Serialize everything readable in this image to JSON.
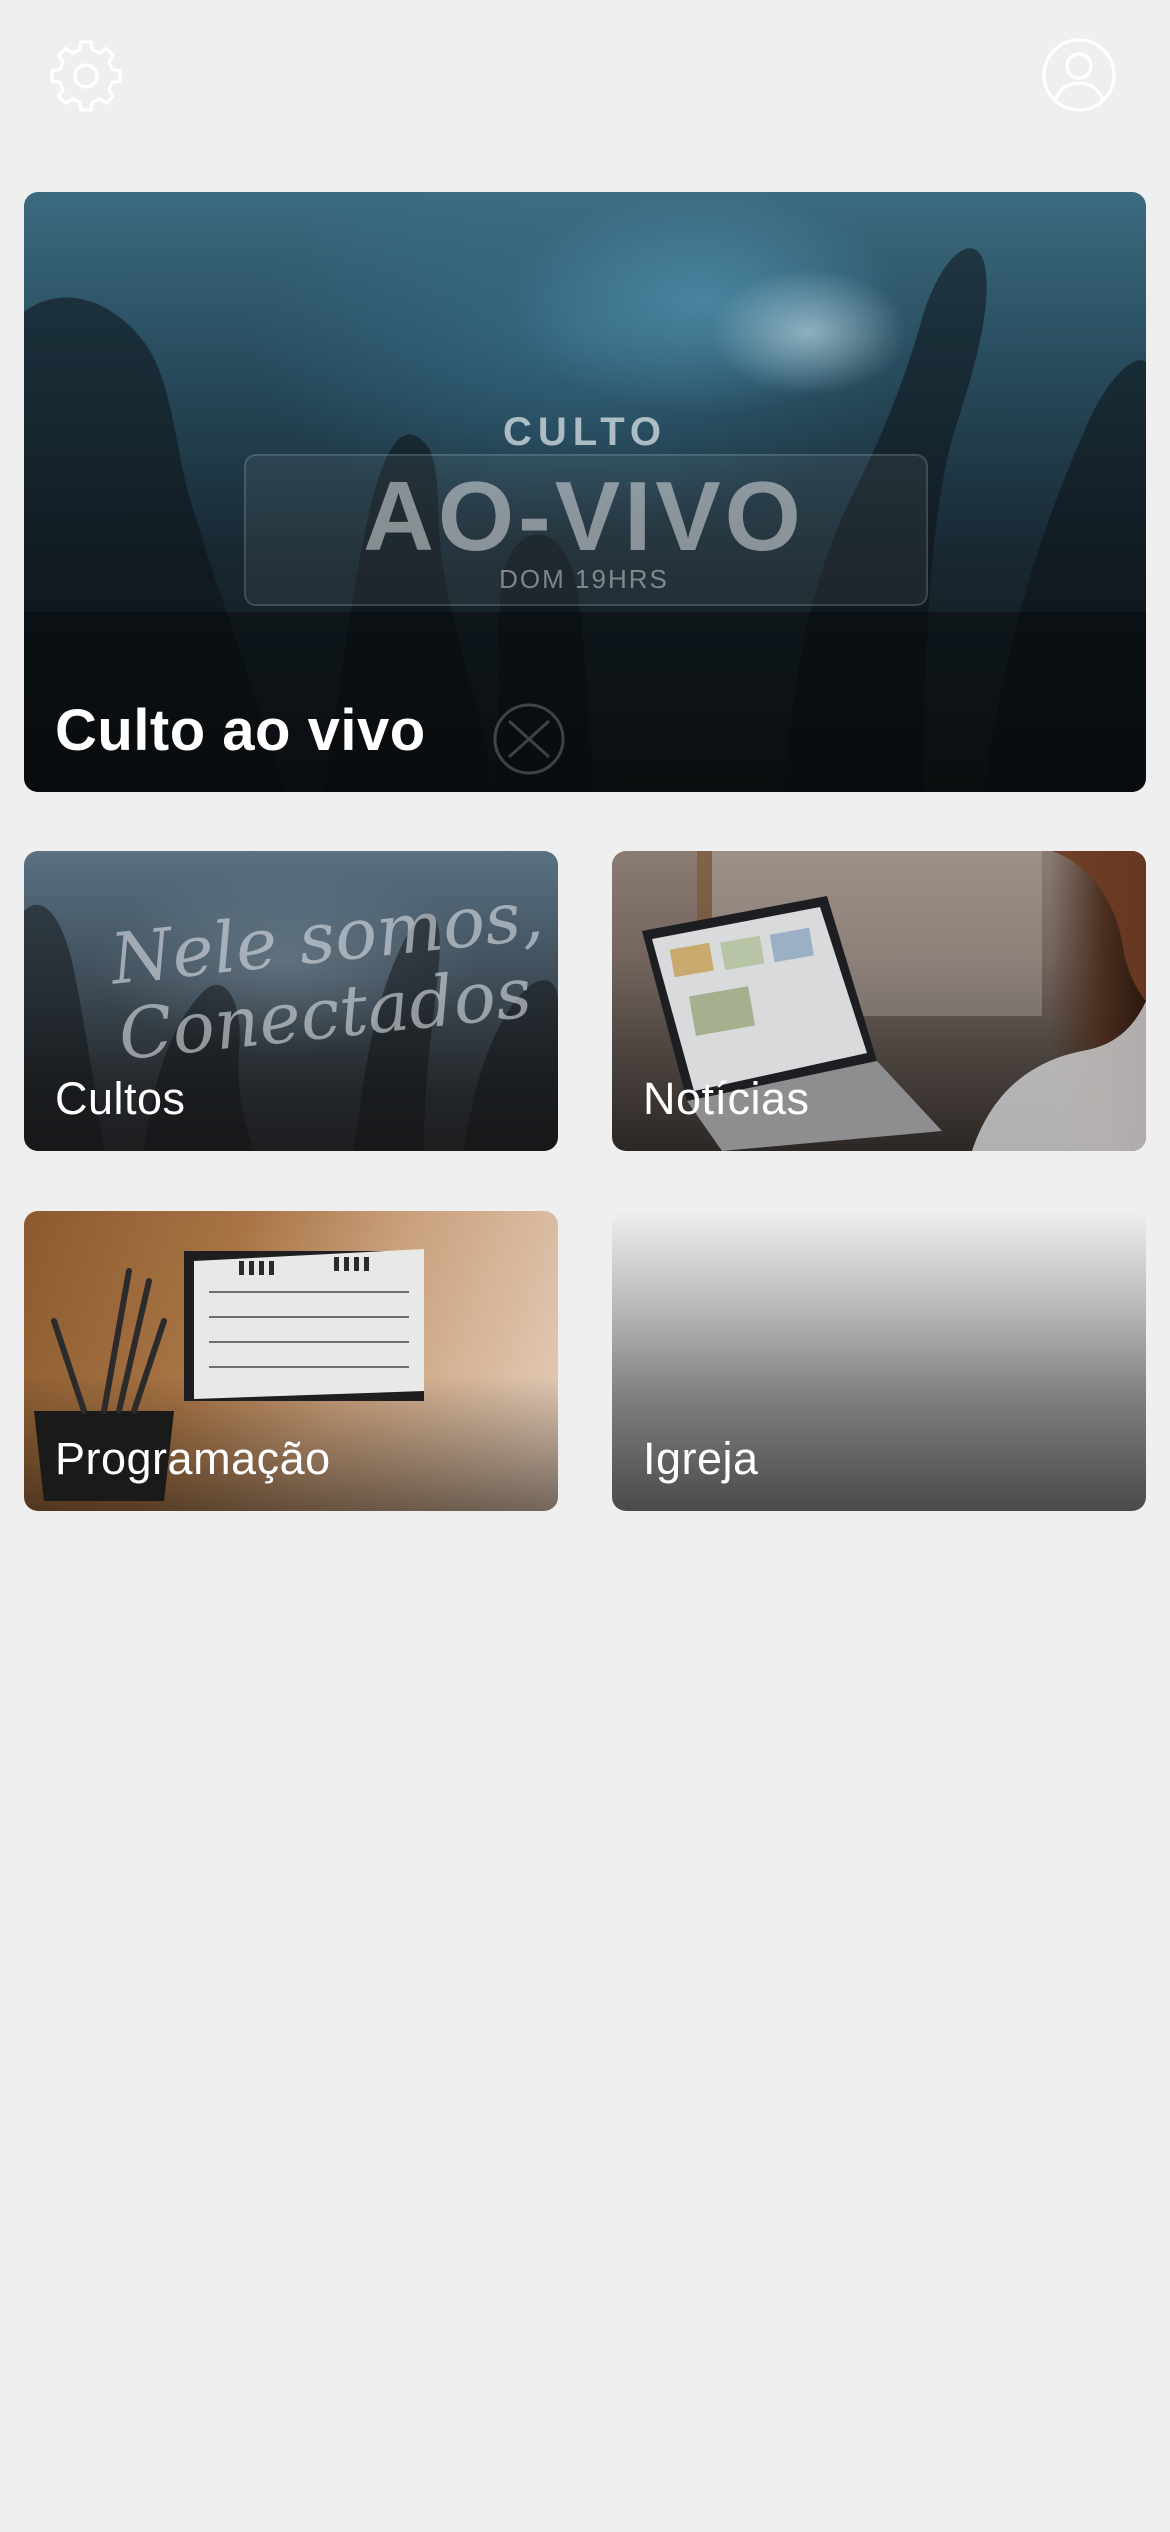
{
  "topbar": {
    "settings_icon": "gear-icon",
    "profile_icon": "user-circle-icon",
    "icon_color": "#ffffff"
  },
  "hero": {
    "label": "Culto ao vivo",
    "poster": {
      "line1": "CULTO",
      "line2": "AO-VIVO",
      "line3": "DOM 19HRS"
    }
  },
  "tiles": [
    {
      "label": "Cultos",
      "image_text": "Nele somos,\nConectados"
    },
    {
      "label": "Notícias"
    },
    {
      "label": "Programação"
    },
    {
      "label": "Igreja"
    }
  ],
  "colors": {
    "background": "#efefef",
    "label_text": "#ffffff"
  }
}
